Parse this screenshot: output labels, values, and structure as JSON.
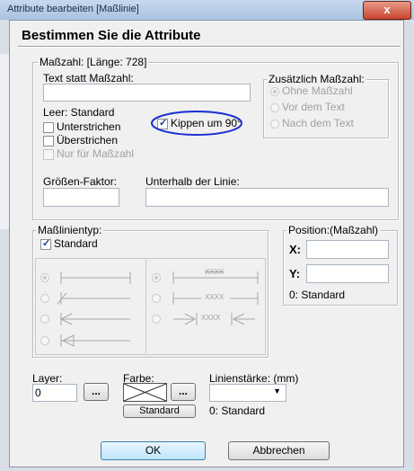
{
  "window": {
    "title": "Attribute bearbeiten [Maßlinie]",
    "close_glyph": "x"
  },
  "heading": "Bestimmen Sie die Attribute",
  "masszahl": {
    "legend": "Maßzahl: [Länge: 728]",
    "text_label": "Text statt Maßzahl:",
    "text_value": "",
    "empty_hint": "Leer: Standard",
    "unterstrichen": "Unterstrichen",
    "ueberstrichen": "Überstrichen",
    "nur_fuer": "Nur für Maßzahl",
    "kippen": "Kippen um 90°",
    "groessen_label": "Größen-Faktor:",
    "groessen_value": "",
    "unterhalb_label": "Unterhalb der Linie:",
    "unterhalb_value": "",
    "zusaetzlich": {
      "legend": "Zusätzlich Maßzahl:",
      "options": [
        "Ohne Maßzahl",
        "Vor dem Text",
        "Nach dem Text"
      ]
    }
  },
  "masslinientyp": {
    "legend": "Maßlinientyp:",
    "standard": "Standard",
    "sample_text": "XXXX"
  },
  "position": {
    "legend": "Position:(Maßzahl)",
    "x_label": "X:",
    "y_label": "Y:",
    "x_value": "",
    "y_value": "",
    "hint": "0: Standard"
  },
  "layer": {
    "label": "Layer:",
    "value": "0",
    "browse": "..."
  },
  "farbe": {
    "label": "Farbe:",
    "browse": "...",
    "standard_button": "Standard"
  },
  "linienstaerke": {
    "label": "Linienstärke: (mm)",
    "value": "",
    "hint": "0: Standard"
  },
  "buttons": {
    "ok": "OK",
    "cancel": "Abbrechen"
  },
  "colors": {
    "annotation_circle": "#1a2fd0",
    "accent": "#3c7fb1"
  }
}
